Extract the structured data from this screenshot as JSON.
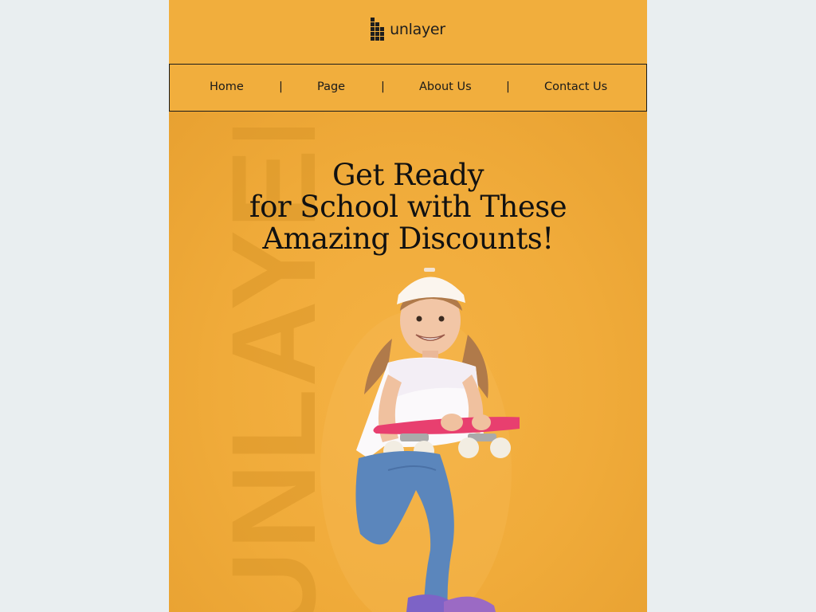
{
  "header": {
    "logo_text": "unlayer",
    "logo_icon": "stacked-squares-logo-icon"
  },
  "nav": {
    "items": [
      {
        "label": "Home"
      },
      {
        "label": "Page"
      },
      {
        "label": "About Us"
      },
      {
        "label": "Contact Us"
      }
    ],
    "separator": "|"
  },
  "hero": {
    "headline_lines": [
      "Get Ready",
      "for School with These",
      "Amazing Discounts!"
    ],
    "watermark_text": "UNLAYER",
    "image_icon": "girl-with-skateboard-photo"
  },
  "colors": {
    "page_bg": "#e9eef0",
    "email_bg": "#f1ae3d",
    "text": "#111111",
    "skateboard": "#e83f6f"
  }
}
